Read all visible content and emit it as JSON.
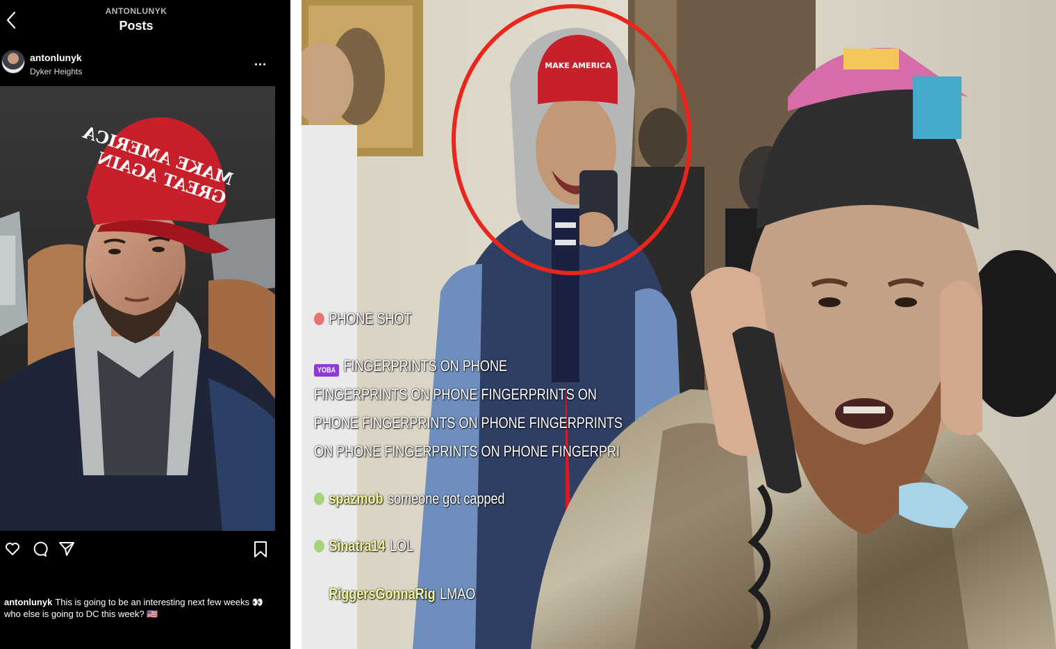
{
  "instagram": {
    "username_caps": "ANTONLUNYK",
    "page_title": "Posts",
    "post": {
      "username": "antonlunyk",
      "location": "Dyker Heights",
      "more_label": "...",
      "hat_text": [
        "MAKE AMERICA",
        "GREAT AGAIN"
      ],
      "caption_user": "antonlunyk",
      "caption_text": "This is going to be an interesting next few weeks 👀 who else is going to DC this week? 🇺🇸"
    },
    "icons": [
      "back-icon",
      "heart-icon",
      "comment-icon",
      "share-icon",
      "bookmark-icon"
    ]
  },
  "stream": {
    "chat": [
      {
        "user": "",
        "text": "PHONE SHOT",
        "badge": "red"
      },
      {
        "user": "YOBA",
        "text": "FINGERPRINTS ON PHONE",
        "badge": "yoba"
      },
      {
        "user": "",
        "text": "FINGERPRINTS ON PHONE FINGERPRINTS ON",
        "badge": ""
      },
      {
        "user": "",
        "text": "PHONE FINGERPRINTS ON PHONE FINGERPRINTS",
        "badge": ""
      },
      {
        "user": "",
        "text": "ON PHONE FINGERPRINTS ON PHONE FINGERPRI",
        "badge": ""
      },
      {
        "user": "spazmob",
        "text": "someone got capped",
        "badge": "green"
      },
      {
        "user": "Sinatra14",
        "text": "LOL",
        "badge": "green"
      },
      {
        "user": "RiggersGonnaRig",
        "text": "LMAO",
        "badge": "white"
      }
    ],
    "highlight_color": "#e8261c",
    "hat_color": "#c8202a"
  }
}
